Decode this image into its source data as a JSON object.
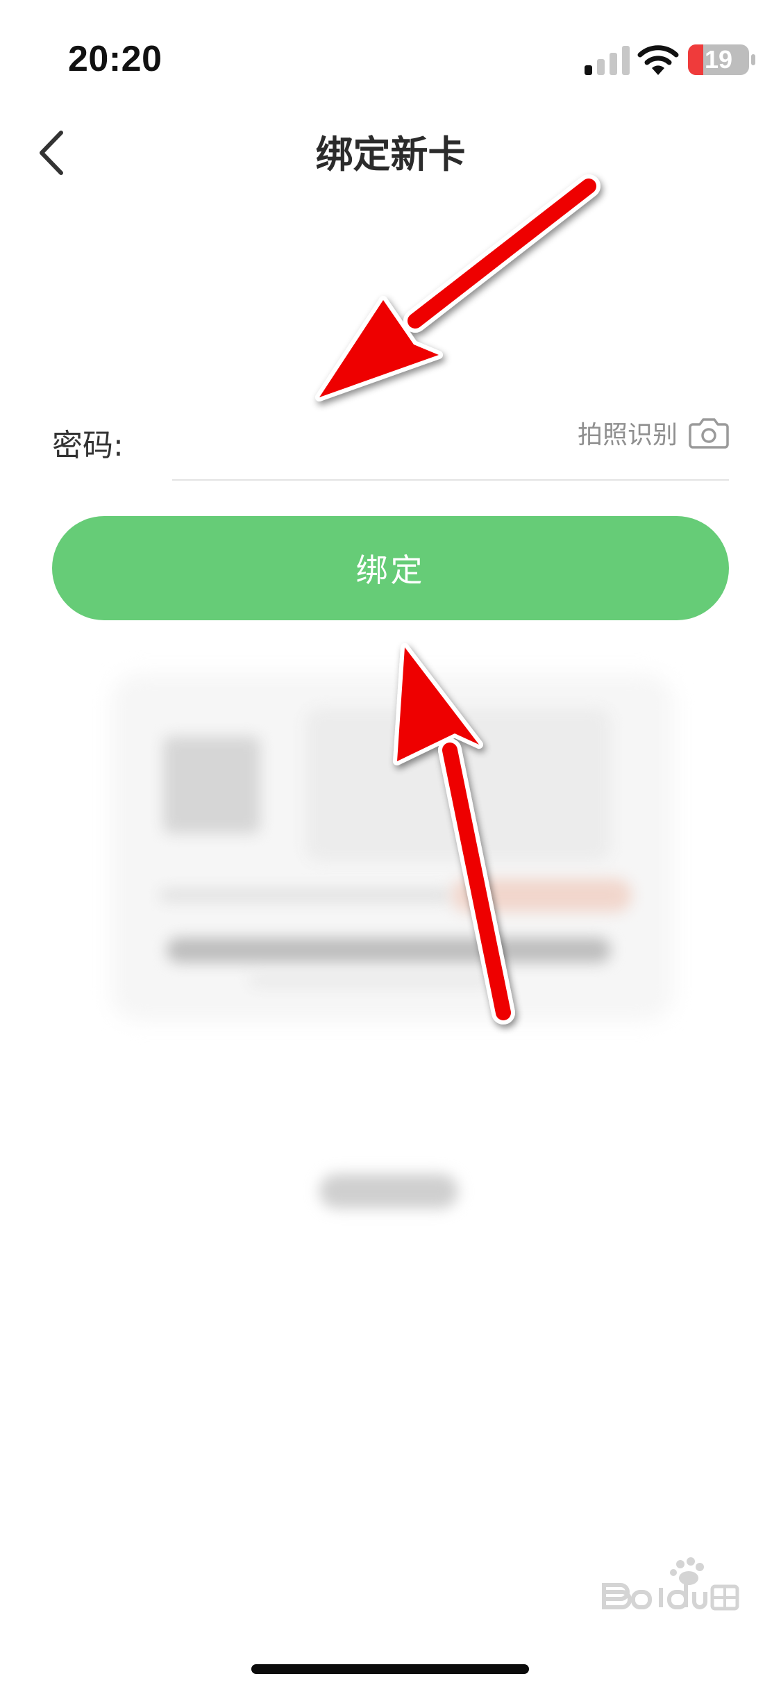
{
  "status_bar": {
    "time": "20:20",
    "battery": "19",
    "icons": [
      "signal-icon",
      "wifi-icon",
      "battery-icon"
    ]
  },
  "header": {
    "title": "绑定新卡",
    "back_icon": "chevron-left-icon"
  },
  "form": {
    "password_label": "密码:",
    "password_value": "",
    "photo_recognize_label": "拍照识别",
    "camera_icon": "camera-icon"
  },
  "actions": {
    "bind_label": "绑定"
  },
  "colors": {
    "accent": "#66cc77",
    "annotation": "#ff0a0a",
    "battery_low": "#ef3b3b"
  }
}
